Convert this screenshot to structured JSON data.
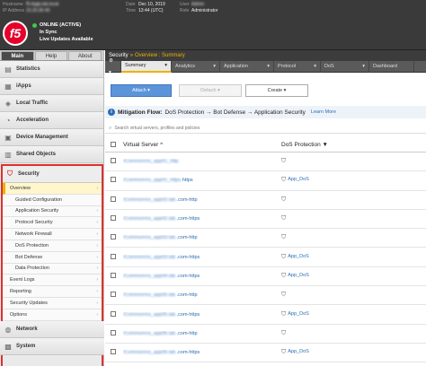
{
  "banner": {
    "hostname_label": "Hostname",
    "hostname_value": "f5-bigip.lab.local",
    "ip_label": "IP Address",
    "ip_value": "10.20.30.40",
    "date_label": "Date",
    "date_value": "Dec 10, 2019",
    "time_label": "Time",
    "time_value": "13:44 (UTC)",
    "user_label": "User",
    "user_value": "Admin",
    "role_label": "Role",
    "role_value": "Administrator",
    "logo_text": "f5",
    "status": [
      "ONLINE (ACTIVE)",
      "In Sync",
      "Live Updates Available"
    ]
  },
  "nav": {
    "tabs": [
      "Main",
      "Help",
      "About"
    ],
    "sections_top": [
      "Statistics",
      "iApps",
      "Local Traffic",
      "Acceleration",
      "Device Management",
      "Shared Objects"
    ],
    "security_label": "Security",
    "security_items": [
      {
        "label": "Overview",
        "arrow": "›"
      },
      {
        "label": "Guided Configuration",
        "arrow": ""
      },
      {
        "label": "Application Security",
        "arrow": "›"
      },
      {
        "label": "Protocol Security",
        "arrow": "›"
      },
      {
        "label": "Network Firewall",
        "arrow": "›"
      },
      {
        "label": "DoS Protection",
        "arrow": "›"
      },
      {
        "label": "Bot Defense",
        "arrow": "›"
      },
      {
        "label": "Data Protection",
        "arrow": "›"
      },
      {
        "label": "Event Logs",
        "arrow": "›"
      },
      {
        "label": "Reporting",
        "arrow": "›"
      },
      {
        "label": "Security Updates",
        "arrow": "›"
      },
      {
        "label": "Options",
        "arrow": "›"
      }
    ],
    "sections_bottom": [
      "Network",
      "System"
    ]
  },
  "content": {
    "crumb_root": "Security",
    "crumb_sep": "»",
    "crumb_path": "Overview : Summary",
    "menubar": [
      {
        "label": "Summary",
        "arrow": "▾"
      },
      {
        "label": "Analytics",
        "arrow": "▾"
      },
      {
        "label": "Application",
        "arrow": "▾"
      },
      {
        "label": "Protocol",
        "arrow": "▾"
      },
      {
        "label": "DoS",
        "arrow": "▾"
      },
      {
        "label": "Dashboard",
        "arrow": ""
      }
    ],
    "attach_label": "Attach",
    "detach_label": "Detach",
    "create_label": "Create",
    "flow_title": "Mitigation Flow:",
    "flow_text": "DoS Protection  →  Bot Defense  →  Application Security",
    "learn_more": "Learn More",
    "search_placeholder": "Search virtual servers, profiles and policies",
    "col_vs": "Virtual Server",
    "col_dos": "DoS Protection",
    "rows": [
      {
        "prefix": "/Common/vs_app01_http",
        "suffix": "",
        "dos": ""
      },
      {
        "prefix": "/Common/vs_app01_https.",
        "suffix": "https",
        "dos": "App_DoS"
      },
      {
        "prefix": "/Common/vs_app02.lab.",
        "suffix": ".com-http",
        "dos": ""
      },
      {
        "prefix": "/Common/vs_app02.lab.",
        "suffix": ".com-https",
        "dos": ""
      },
      {
        "prefix": "/Common/vs_app03.lab.",
        "suffix": ".com-http",
        "dos": ""
      },
      {
        "prefix": "/Common/vs_app03.lab.",
        "suffix": ".com-https",
        "dos": "App_DoS"
      },
      {
        "prefix": "/Common/vs_app04.lab.",
        "suffix": ".com-https",
        "dos": "App_DoS"
      },
      {
        "prefix": "/Common/vs_app05.lab.",
        "suffix": ".com-http",
        "dos": ""
      },
      {
        "prefix": "/Common/vs_app05.lab.",
        "suffix": ".com-https",
        "dos": "App_DoS"
      },
      {
        "prefix": "/Common/vs_app06.lab.",
        "suffix": ".com-http",
        "dos": ""
      },
      {
        "prefix": "/Common/vs_app06.lab.",
        "suffix": ".com-https",
        "dos": "App_DoS"
      }
    ]
  },
  "colors": {
    "accent": "#f0b000",
    "brand": "#e4002b",
    "link": "#2a6cb5",
    "highlight_box": "#e03030"
  }
}
